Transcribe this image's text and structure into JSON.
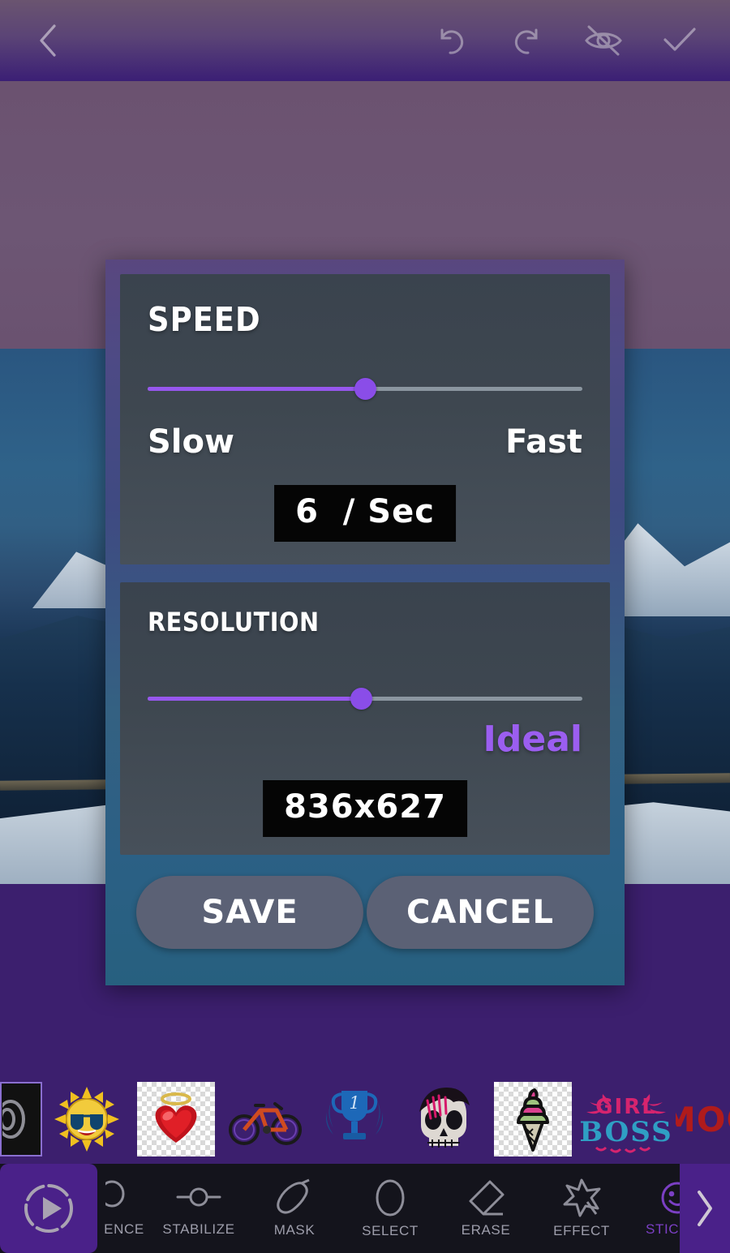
{
  "topbar": {
    "back_icon": "chevron-left-icon",
    "actions": [
      {
        "name": "undo-icon",
        "label": "Undo"
      },
      {
        "name": "redo-icon",
        "label": "Redo"
      },
      {
        "name": "eye-off-icon",
        "label": "Hide"
      },
      {
        "name": "check-icon",
        "label": "Apply"
      }
    ]
  },
  "dialog": {
    "speed": {
      "title": "SPEED",
      "slider_percent": 50,
      "min_label": "Slow",
      "max_label": "Fast",
      "value": "6  / Sec"
    },
    "resolution": {
      "title": "RESOLUTION",
      "slider_percent": 49,
      "hint_label": "Ideal",
      "value": "836x627"
    },
    "save_label": "SAVE",
    "cancel_label": "CANCEL",
    "accent_color": "#9757ee",
    "thumb_color": "#8a4de8",
    "ideal_color": "#9b5ef0"
  },
  "stickers": [
    {
      "name": "sticker-dark-swirl",
      "glyph": "◉"
    },
    {
      "name": "sticker-sun-sunglasses",
      "glyph": "🌞"
    },
    {
      "name": "sticker-heart-halo",
      "glyph": "❤"
    },
    {
      "name": "sticker-bicycle",
      "glyph": "🚲"
    },
    {
      "name": "sticker-trophy-one",
      "glyph": "🏆"
    },
    {
      "name": "sticker-skull-emo",
      "glyph": "💀"
    },
    {
      "name": "sticker-ice-cream-cone",
      "glyph": "🍦"
    },
    {
      "name": "sticker-girl-boss-text",
      "glyph": "GIRL BOSS"
    },
    {
      "name": "sticker-mood-text",
      "glyph": "MOOD"
    }
  ],
  "toolbar": {
    "play_label": "Play",
    "tools": [
      {
        "name": "tool-sequence",
        "label": "ENCE",
        "icon": "circle-icon",
        "active": false
      },
      {
        "name": "tool-stabilize",
        "label": "STABILIZE",
        "icon": "node-icon",
        "active": false
      },
      {
        "name": "tool-mask",
        "label": "MASK",
        "icon": "brush-icon",
        "active": false
      },
      {
        "name": "tool-select",
        "label": "SELECT",
        "icon": "ellipse-icon",
        "active": false
      },
      {
        "name": "tool-erase",
        "label": "ERASE",
        "icon": "eraser-icon",
        "active": false
      },
      {
        "name": "tool-effect",
        "label": "EFFECT",
        "icon": "star-wand-icon",
        "active": false
      },
      {
        "name": "tool-sticker",
        "label": "STICKER",
        "icon": "smiley-icon",
        "active": true
      }
    ],
    "next_icon": "chevron-right-icon"
  }
}
